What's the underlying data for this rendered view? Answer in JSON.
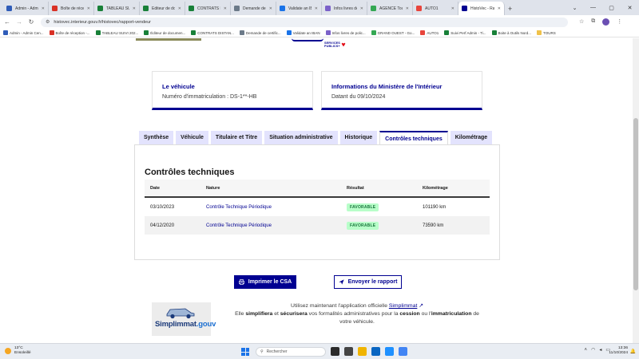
{
  "browser": {
    "tabs": [
      {
        "label": "Admin - Admin",
        "color": "#2f5cb8"
      },
      {
        "label": "Boîte de récep",
        "color": "#d93025"
      },
      {
        "label": "TABLEAU SUIVI",
        "color": "#188038"
      },
      {
        "label": "Éditeur de doc",
        "color": "#188038"
      },
      {
        "label": "CONTRATS DI",
        "color": "#188038"
      },
      {
        "label": "Demande de c",
        "color": "#6c7a89"
      },
      {
        "label": "Validate an IBA",
        "color": "#1a73e8"
      },
      {
        "label": "Infos livres de",
        "color": "#7b61c9"
      },
      {
        "label": "AGENCE Tours",
        "color": "#34a853"
      },
      {
        "label": "AUTO1",
        "color": "#e8453c"
      },
      {
        "label": "HistoVec - Rap",
        "color": "#000091",
        "active": true
      }
    ],
    "url": "histovec.interieur.gouv.fr/histovec/rapport-vendeur",
    "bookmarks": [
      {
        "label": "Admin - Admin Cen...",
        "color": "#2f5cb8"
      },
      {
        "label": "Boîte de réception -...",
        "color": "#d93025"
      },
      {
        "label": "TABLEAU SUIVI 202...",
        "color": "#188038"
      },
      {
        "label": "Éditeur de documen...",
        "color": "#188038"
      },
      {
        "label": "CONTRATS DISTAN...",
        "color": "#188038"
      },
      {
        "label": "Demande de certific...",
        "color": "#6c7a89"
      },
      {
        "label": "Validate an IBAN",
        "color": "#1a73e8"
      },
      {
        "label": "Infos livres de polic...",
        "color": "#7b61c9"
      },
      {
        "label": "GRAND OUEST - Go...",
        "color": "#34a853"
      },
      {
        "label": "AUTO1",
        "color": "#e8453c"
      },
      {
        "label": "Suivi Perf Admin - Ti...",
        "color": "#188038"
      },
      {
        "label": "Boite à Outils Nord...",
        "color": "#188038"
      },
      {
        "label": "TOURS",
        "folder": true
      }
    ]
  },
  "logo": {
    "line1": "SERVICES",
    "line2": "PUBLICS+"
  },
  "cards": {
    "vehicle": {
      "title": "Le véhicule",
      "text": "Numéro d'immatriculation : DS-1**-HB"
    },
    "ministry": {
      "title": "Informations du Ministère de l'Intérieur",
      "text": "Datant du 09/10/2024"
    }
  },
  "report_tabs": [
    {
      "label": "Synthèse"
    },
    {
      "label": "Véhicule"
    },
    {
      "label": "Titulaire et Titre"
    },
    {
      "label": "Situation administrative"
    },
    {
      "label": "Historique"
    },
    {
      "label": "Contrôles techniques",
      "active": true
    },
    {
      "label": "Kilométrage"
    }
  ],
  "controls": {
    "title": "Contrôles techniques",
    "headers": [
      "Date",
      "Nature",
      "Résultat",
      "Kilométrage"
    ],
    "rows": [
      {
        "date": "03/10/2023",
        "nature": "Contrôle Technique Périodique",
        "result": "FAVORABLE",
        "km": "101190 km"
      },
      {
        "date": "04/12/2020",
        "nature": "Contrôle Technique Périodique",
        "result": "FAVORABLE",
        "km": "73590 km"
      }
    ]
  },
  "actions": {
    "print": "Imprimer le CSA",
    "send": "Envoyer le rapport"
  },
  "promo": {
    "brand": "Simplimmat",
    "brand_suffix": ".gouv",
    "line1_pre": "Utilisez maintenant l'application officielle",
    "link": "Simplimmat",
    "l2_a": "Elle",
    "l2_b": "simplifiera",
    "l2_c": "et",
    "l2_d": "sécurisera",
    "l2_e": "vos formalités administratives pour la",
    "l2_f": "cession",
    "l2_g": "ou l'",
    "l2_h": "immatriculation",
    "l2_i": "de votre véhicule."
  },
  "taskbar": {
    "temp": "13°C",
    "weather": "Ensoleillé",
    "search": "Rechercher",
    "time": "13:36",
    "date": "11/10/2024",
    "icon_colors": [
      "#2b2b2b",
      "#444444",
      "#f0b400",
      "#0a66c2",
      "#1e90ff",
      "#4285f4"
    ]
  },
  "colors": {
    "accent": "#000091",
    "success_bg": "#b8fec9",
    "success_text": "#18753c"
  }
}
